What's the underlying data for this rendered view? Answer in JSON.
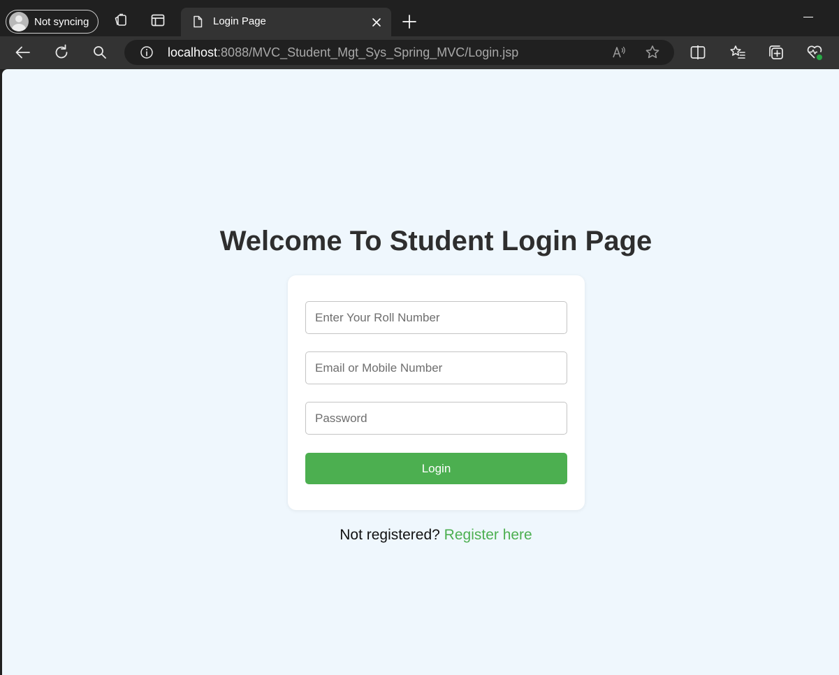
{
  "browser": {
    "profile_label": "Not syncing",
    "tab_title": "Login Page",
    "address": {
      "host": "localhost",
      "rest": ":8088/MVC_Student_Mgt_Sys_Spring_MVC/Login.jsp"
    },
    "icons": {
      "profile": "avatar-icon",
      "workspaces": "workspaces-icon",
      "tab_actions": "tab-actions-icon",
      "tab_page": "page-icon",
      "tab_close": "close-icon",
      "new_tab": "plus-icon",
      "back": "back-arrow-icon",
      "refresh": "refresh-icon",
      "search": "search-icon",
      "site_info": "info-icon",
      "read_aloud": "read-aloud-icon",
      "favorite": "star-icon",
      "split_screen": "split-screen-icon",
      "favorites": "favorites-icon",
      "collections": "collections-icon",
      "browser_essentials": "heart-pulse-icon"
    }
  },
  "page": {
    "title": "Welcome To Student Login Page",
    "form": {
      "roll_placeholder": "Enter Your Roll Number",
      "roll_value": "",
      "contact_placeholder": "Email or Mobile Number",
      "contact_value": "",
      "password_placeholder": "Password",
      "password_value": "",
      "submit_label": "Login"
    },
    "register_prompt": "Not registered?",
    "register_link": "Register here"
  },
  "colors": {
    "accent": "#4caf50",
    "page_background": "#eff7fd",
    "title_text": "#2e2e2e",
    "browser_chrome": "#202020",
    "toolbar": "#333333"
  }
}
